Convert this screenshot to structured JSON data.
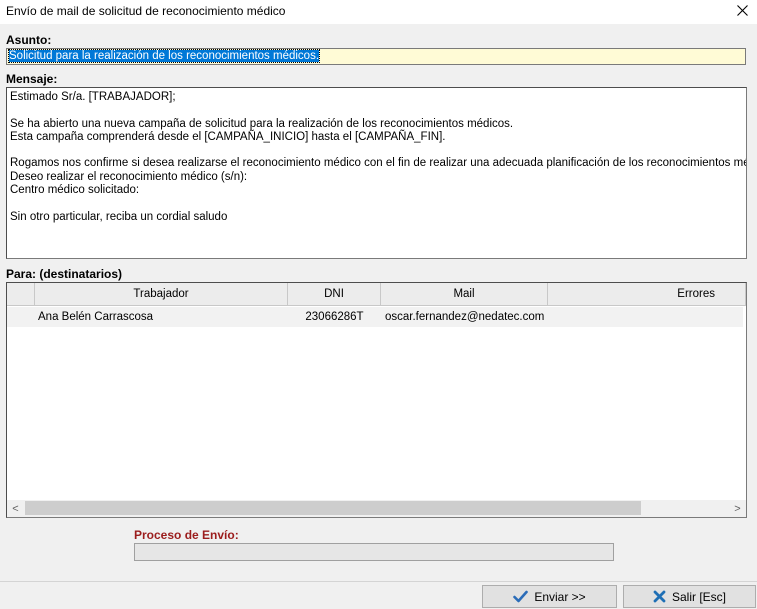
{
  "window": {
    "title": "Envío de mail de solicitud de reconocimiento médico",
    "close_glyph": "✕"
  },
  "subject": {
    "label": "Asunto:",
    "value": "Solicitud para la realización de los reconocimientos médicos."
  },
  "message": {
    "label": "Mensaje:",
    "lines": [
      "Estimado Sr/a. [TRABAJADOR];",
      "",
      "Se ha abierto una nueva campaña de solicitud para la realización de los reconocimientos médicos.",
      "Esta campaña comprenderá desde el [CAMPAÑA_INICIO] hasta el [CAMPAÑA_FIN].",
      "",
      "Rogamos nos confirme si desea realizarse el reconocimiento médico con el fin de realizar una adecuada planificación de los reconocimientos médicos.",
      "Deseo realizar el reconocimiento médico (s/n):",
      "Centro médico solicitado:",
      "",
      "Sin otro particular, reciba un cordial saludo"
    ]
  },
  "recipients": {
    "label": "Para: (destinatarios)",
    "columns": [
      "Trabajador",
      "DNI",
      "Mail",
      "Errores"
    ],
    "rows": [
      [
        "Ana Belén Carrascosa",
        "23066286T",
        "oscar.fernandez@nedatec.com",
        ""
      ]
    ]
  },
  "scrollbar": {
    "left_arrow": "<",
    "right_arrow": ">"
  },
  "progress": {
    "label": "Proceso de Envío:",
    "value": 0
  },
  "buttons": {
    "send": "Enviar >>",
    "exit": "Salir  [Esc]"
  },
  "colors": {
    "selection": "#0078d7",
    "subject_bg": "#fffbd6",
    "proceso_label": "#9b1c1c",
    "send_icon": "#2b6cb8",
    "exit_icon": "#1f6fb5"
  },
  "icons": {
    "send": "checkmark-icon",
    "exit": "x-icon",
    "close": "close-icon"
  }
}
